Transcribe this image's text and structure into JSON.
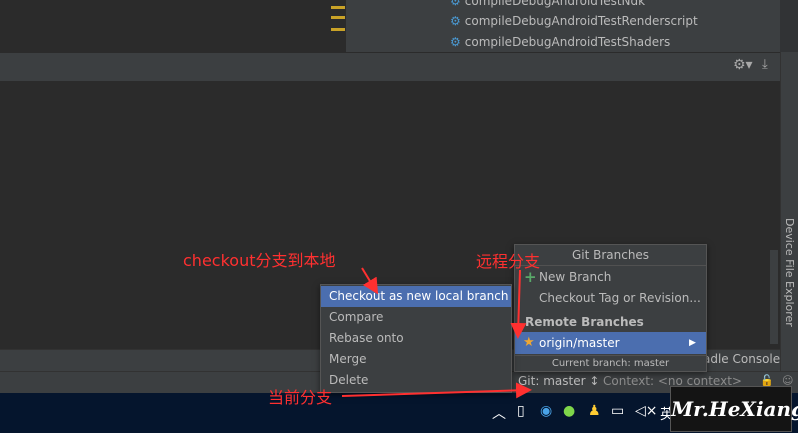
{
  "gradle_tasks": [
    "compileDebugAndroidTestNdk",
    "compileDebugAndroidTestRenderscript",
    "compileDebugAndroidTestShaders"
  ],
  "side_tab_label": "Device File Explorer",
  "bottom_bar": {
    "gradle_console_label": "adle Console"
  },
  "status_bar": {
    "git_branch": "Git: master ↕",
    "context": "Context: <no context>"
  },
  "git_branches_popup": {
    "title": "Git Branches",
    "new_branch": "New Branch",
    "checkout_tag": "Checkout Tag or Revision...",
    "remote_header": "Remote Branches",
    "remote_branch": "origin/master",
    "current_branch": "Current branch: master"
  },
  "branch_menu": {
    "items": [
      "Checkout as new local branch",
      "Compare",
      "Rebase onto",
      "Merge",
      "Delete"
    ]
  },
  "annotations": {
    "checkout_note": "checkout分支到本地",
    "remote_note": "远程分支",
    "current_note": "当前分支"
  },
  "taskbar": {
    "ime_label": "英"
  },
  "watermark": "Mr.HeXiang",
  "colors": {
    "selection": "#4b6eaf",
    "annotation": "#ff3030",
    "panel": "#3c3f41",
    "editor": "#2b2b2b"
  }
}
